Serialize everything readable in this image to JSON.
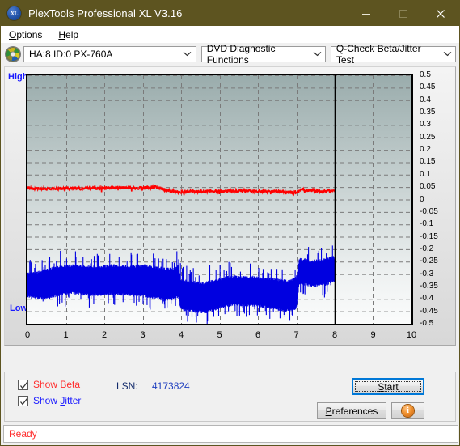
{
  "window": {
    "title": "PlexTools Professional XL V3.16",
    "icon": "xl-app-icon",
    "minimize": "minimize-icon",
    "maximize": "maximize-icon",
    "close": "close-icon"
  },
  "menubar": {
    "items": [
      {
        "label": "Options",
        "accel": "O"
      },
      {
        "label": "Help",
        "accel": "H"
      }
    ]
  },
  "toolbar": {
    "disc_icon": "optical-disc-icon",
    "drive_select": "HA:8 ID:0  PX-760A",
    "function_select": "DVD Diagnostic Functions",
    "test_select": "Q-Check Beta/Jitter Test"
  },
  "chart_labels": {
    "high": "High",
    "low": "Low"
  },
  "controls": {
    "show_beta": {
      "label": "Show Beta",
      "accel": "B",
      "checked": true,
      "color": "#ff2d2d"
    },
    "show_jitter": {
      "label": "Show Jitter",
      "accel": "J",
      "checked": true,
      "color": "#1a1aff"
    },
    "lsn_label": "LSN:",
    "lsn_value": "4173824",
    "start_button": "Start",
    "preferences_button": "Preferences",
    "info_button": "i"
  },
  "statusbar": {
    "text": "Ready"
  },
  "colors": {
    "titlebar": "#5d5420",
    "beta": "#ff0000",
    "jitter": "#0000e0",
    "plot_top": "#9aacac",
    "plot_bottom": "#fbfcfc",
    "accent": "#0078d7",
    "status_text": "#ff2d2d"
  },
  "chart_data": {
    "type": "line",
    "title": "Q-Check Beta/Jitter Test",
    "xlabel": "",
    "ylabel": "",
    "xlim": [
      0,
      10
    ],
    "ylim": [
      -0.5,
      0.5
    ],
    "grid": true,
    "legend": "none",
    "x_ticks": [
      "0",
      "1",
      "2",
      "3",
      "4",
      "5",
      "6",
      "7",
      "8",
      "9",
      "10"
    ],
    "y_ticks": [
      "0.5",
      "0.45",
      "0.4",
      "0.35",
      "0.3",
      "0.25",
      "0.2",
      "0.15",
      "0.1",
      "0.05",
      "0",
      "-0.05",
      "-0.1",
      "-0.15",
      "-0.2",
      "-0.25",
      "-0.3",
      "-0.35",
      "-0.4",
      "-0.45",
      "-0.5"
    ],
    "data_end_x": 8,
    "series": [
      {
        "name": "Beta",
        "color": "#ff0000",
        "type": "noisy-line",
        "x": [
          0.0,
          0.2,
          0.4,
          0.6,
          0.8,
          1.0,
          1.2,
          1.4,
          1.6,
          1.8,
          2.0,
          2.2,
          2.4,
          2.6,
          2.8,
          3.0,
          3.2,
          3.35,
          3.5,
          3.6,
          3.8,
          3.95,
          4.05,
          4.2,
          4.4,
          4.6,
          4.8,
          5.0,
          5.2,
          5.4,
          5.6,
          5.8,
          6.0,
          6.2,
          6.4,
          6.6,
          6.8,
          6.95,
          7.05,
          7.15,
          7.3,
          7.5,
          7.7,
          7.9,
          8.0
        ],
        "y": [
          0.047,
          0.045,
          0.044,
          0.043,
          0.043,
          0.044,
          0.045,
          0.044,
          0.045,
          0.046,
          0.047,
          0.046,
          0.048,
          0.047,
          0.046,
          0.047,
          0.048,
          0.05,
          0.044,
          0.038,
          0.034,
          0.028,
          0.031,
          0.032,
          0.032,
          0.033,
          0.033,
          0.034,
          0.034,
          0.035,
          0.035,
          0.034,
          0.034,
          0.033,
          0.033,
          0.031,
          0.028,
          0.026,
          0.031,
          0.043,
          0.035,
          0.036,
          0.034,
          0.035,
          0.038
        ],
        "noise": 0.006
      },
      {
        "name": "Jitter",
        "color": "#0000e0",
        "type": "noise-band",
        "x": [
          0.0,
          0.2,
          0.4,
          0.6,
          0.8,
          1.0,
          1.2,
          1.4,
          1.6,
          1.8,
          2.0,
          2.2,
          2.4,
          2.6,
          2.8,
          3.0,
          3.2,
          3.4,
          3.6,
          3.8,
          3.92,
          4.0,
          4.2,
          4.4,
          4.6,
          4.8,
          5.0,
          5.2,
          5.4,
          5.6,
          5.8,
          6.0,
          6.2,
          6.4,
          6.6,
          6.8,
          7.0,
          7.08,
          7.2,
          7.4,
          7.6,
          7.8,
          7.95
        ],
        "y_top": [
          -0.3,
          -0.296,
          -0.286,
          -0.278,
          -0.272,
          -0.268,
          -0.266,
          -0.268,
          -0.27,
          -0.272,
          -0.27,
          -0.266,
          -0.268,
          -0.268,
          -0.268,
          -0.266,
          -0.27,
          -0.274,
          -0.28,
          -0.278,
          -0.266,
          -0.324,
          -0.33,
          -0.334,
          -0.336,
          -0.33,
          -0.32,
          -0.312,
          -0.31,
          -0.314,
          -0.312,
          -0.314,
          -0.316,
          -0.32,
          -0.326,
          -0.33,
          -0.316,
          -0.238,
          -0.24,
          -0.248,
          -0.246,
          -0.24,
          -0.232
        ],
        "y_bot": [
          -0.39,
          -0.396,
          -0.398,
          -0.394,
          -0.384,
          -0.378,
          -0.376,
          -0.38,
          -0.382,
          -0.384,
          -0.382,
          -0.38,
          -0.382,
          -0.384,
          -0.386,
          -0.386,
          -0.392,
          -0.398,
          -0.404,
          -0.4,
          -0.392,
          -0.44,
          -0.448,
          -0.452,
          -0.454,
          -0.448,
          -0.436,
          -0.428,
          -0.424,
          -0.426,
          -0.426,
          -0.428,
          -0.432,
          -0.438,
          -0.444,
          -0.446,
          -0.436,
          -0.336,
          -0.34,
          -0.348,
          -0.346,
          -0.34,
          -0.33
        ],
        "spike": 0.035
      }
    ]
  }
}
